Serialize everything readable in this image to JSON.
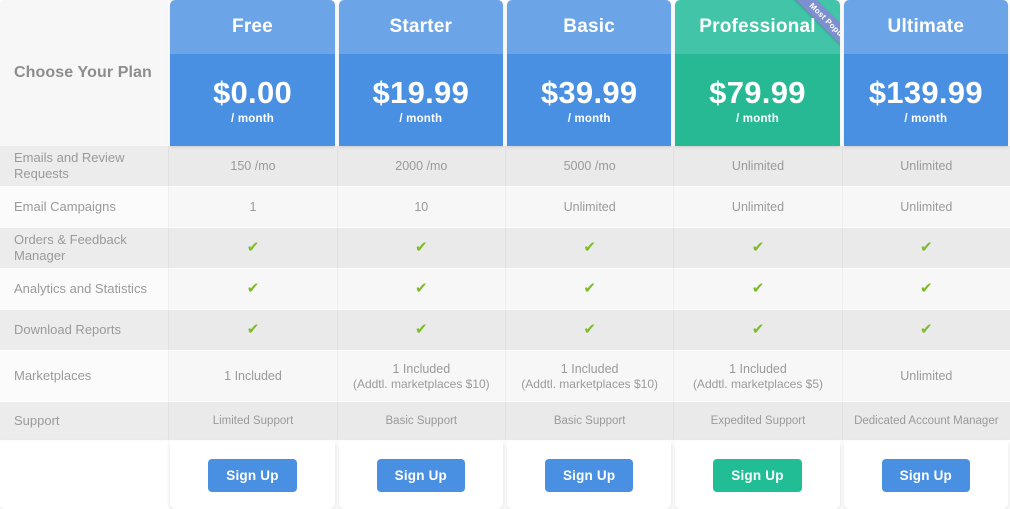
{
  "table": {
    "corner_label": "Choose Your Plan",
    "ribbon_text": "Most Popular",
    "accent_blue": "#4a90e2",
    "accent_blue_light": "#6ba5e7",
    "accent_green": "#27b894",
    "accent_green_light": "#41c4a7",
    "ribbon_color": "#7e8fd0",
    "check_color": "#7dbc28",
    "check_glyph": "✔",
    "per_month": "/ month",
    "signup_label": "Sign Up",
    "plans": [
      {
        "name": "Free",
        "price": "$0.00",
        "theme": "blue",
        "popular": false
      },
      {
        "name": "Starter",
        "price": "$19.99",
        "theme": "blue",
        "popular": false
      },
      {
        "name": "Basic",
        "price": "$39.99",
        "theme": "blue",
        "popular": false
      },
      {
        "name": "Professional",
        "price": "$79.99",
        "theme": "green",
        "popular": true
      },
      {
        "name": "Ultimate",
        "price": "$139.99",
        "theme": "blue",
        "popular": false
      }
    ],
    "rows": [
      {
        "label": "Emails and Review Requests",
        "values": [
          "150 /mo",
          "2000 /mo",
          "5000 /mo",
          "Unlimited",
          "Unlimited"
        ]
      },
      {
        "label": "Email Campaigns",
        "values": [
          "1",
          "10",
          "Unlimited",
          "Unlimited",
          "Unlimited"
        ]
      },
      {
        "label": "Orders & Feedback Manager",
        "values": [
          "check",
          "check",
          "check",
          "check",
          "check"
        ]
      },
      {
        "label": "Analytics and Statistics",
        "values": [
          "check",
          "check",
          "check",
          "check",
          "check"
        ]
      },
      {
        "label": "Download Reports",
        "values": [
          "check",
          "check",
          "check",
          "check",
          "check"
        ]
      },
      {
        "label": "Marketplaces",
        "values": [
          "1 Included",
          "1 Included",
          "1 Included",
          "1 Included",
          "Unlimited"
        ],
        "sub_values": [
          "",
          "(Addtl. marketplaces $10)",
          "(Addtl. marketplaces $10)",
          "(Addtl. marketplaces $5)",
          ""
        ]
      },
      {
        "label": "Support",
        "values": [
          "Limited Support",
          "Basic Support",
          "Basic Support",
          "Expedited Support",
          "Dedicated Account Manager"
        ]
      }
    ]
  }
}
